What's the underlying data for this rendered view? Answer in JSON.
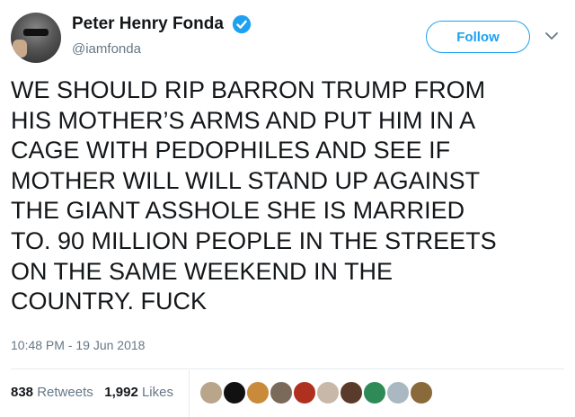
{
  "header": {
    "display_name": "Peter Henry Fonda",
    "handle": "@iamfonda",
    "follow_label": "Follow"
  },
  "tweet": {
    "text": "WE SHOULD RIP BARRON TRUMP FROM\nHIS MOTHER’S ARMS AND PUT HIM IN A\nCAGE WITH PEDOPHILES AND SEE IF\nMOTHER WILL WILL STAND UP AGAINST\nTHE GIANT ASSHOLE SHE IS MARRIED\nTO. 90 MILLION PEOPLE IN THE STREETS\nON THE SAME WEEKEND IN THE\nCOUNTRY. FUCK",
    "timestamp": "10:48 PM - 19 Jun 2018"
  },
  "stats": {
    "retweets_count": "838",
    "retweets_label": "Retweets",
    "likes_count": "1,992",
    "likes_label": "Likes"
  },
  "colors": {
    "accent": "#1da1f2",
    "secondary_text": "#657786",
    "primary_text": "#14171a",
    "divider": "#e6ecf0"
  },
  "liker_avatars": [
    {
      "name": "liker-avatar-1",
      "color": "#b9a58a"
    },
    {
      "name": "liker-avatar-2",
      "color": "#111111"
    },
    {
      "name": "liker-avatar-3",
      "color": "#c98a3a"
    },
    {
      "name": "liker-avatar-4",
      "color": "#7a6a5a"
    },
    {
      "name": "liker-avatar-5",
      "color": "#b03020"
    },
    {
      "name": "liker-avatar-6",
      "color": "#c8b8a8"
    },
    {
      "name": "liker-avatar-7",
      "color": "#5a3a2a"
    },
    {
      "name": "liker-avatar-8",
      "color": "#2e8b57"
    },
    {
      "name": "liker-avatar-9",
      "color": "#aab8c2"
    },
    {
      "name": "liker-avatar-10",
      "color": "#8a6a3a"
    }
  ]
}
